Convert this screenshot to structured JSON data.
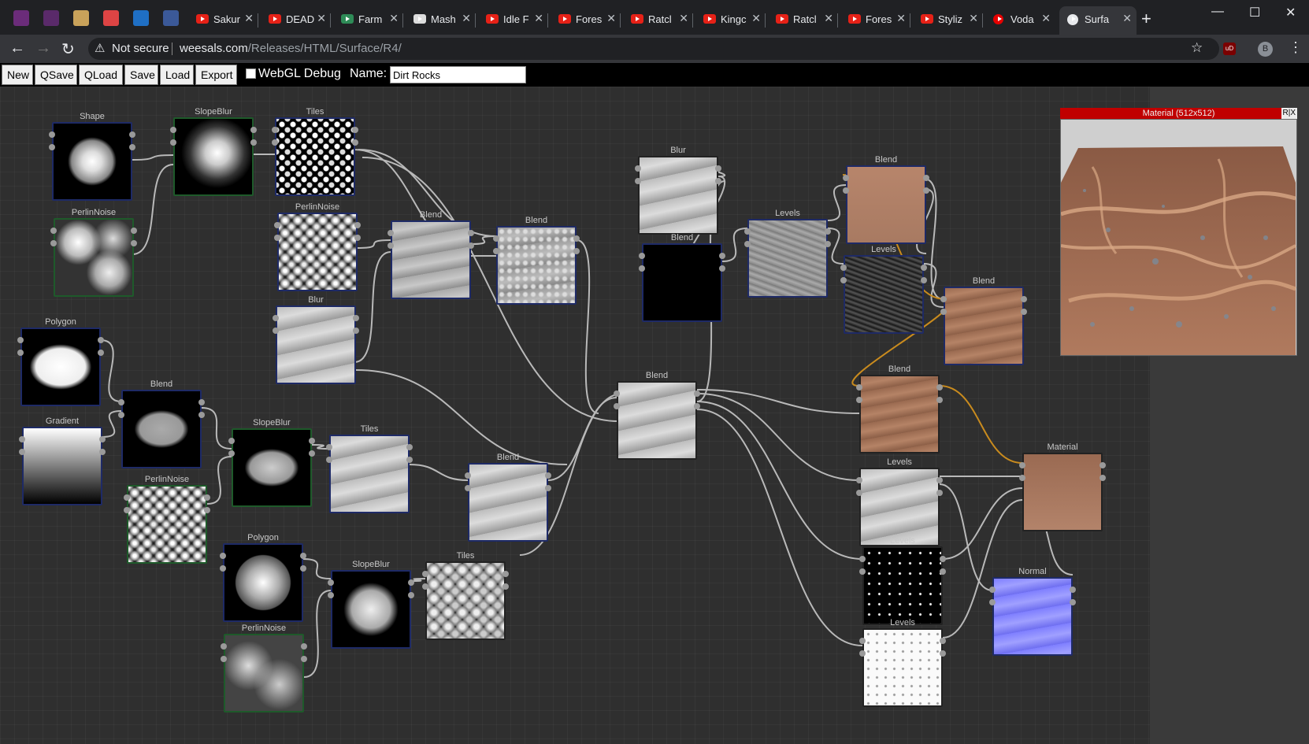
{
  "browser": {
    "tabs": [
      {
        "label": "Sakur"
      },
      {
        "label": "DEAD"
      },
      {
        "label": "Farm"
      },
      {
        "label": "Mash"
      },
      {
        "label": "Idle F"
      },
      {
        "label": "Fores"
      },
      {
        "label": "Ratcl"
      },
      {
        "label": "Kingc"
      },
      {
        "label": "Ratcl"
      },
      {
        "label": "Fores"
      },
      {
        "label": "Styliz"
      },
      {
        "label": "Voda"
      },
      {
        "label": "Surfa"
      }
    ],
    "security_label": "Not secure",
    "url_host": "weesals.com",
    "url_path": "/Releases/HTML/Surface/R4/",
    "profile_initial": "B",
    "extension_label": "uD"
  },
  "app": {
    "buttons": {
      "new": "New",
      "qsave": "QSave",
      "qload": "QLoad",
      "save": "Save",
      "load": "Load",
      "export": "Export"
    },
    "webgl_debug_label": "WebGL Debug",
    "name_label": "Name:",
    "name_value": "Dirt Rocks"
  },
  "preview": {
    "title": "Material (512x512)",
    "controls": "R|X"
  },
  "nodes": [
    {
      "id": "shape",
      "title": "Shape"
    },
    {
      "id": "slopeblur1",
      "title": "SlopeBlur"
    },
    {
      "id": "tiles1",
      "title": "Tiles"
    },
    {
      "id": "perlin1",
      "title": "PerlinNoise"
    },
    {
      "id": "perlin2",
      "title": "PerlinNoise"
    },
    {
      "id": "blend1",
      "title": "Blend"
    },
    {
      "id": "blend2",
      "title": "Blend"
    },
    {
      "id": "blur1",
      "title": "Blur"
    },
    {
      "id": "polygon1",
      "title": "Polygon"
    },
    {
      "id": "gradient",
      "title": "Gradient"
    },
    {
      "id": "blend3",
      "title": "Blend"
    },
    {
      "id": "perlin3",
      "title": "PerlinNoise"
    },
    {
      "id": "slopeblur2",
      "title": "SlopeBlur"
    },
    {
      "id": "tiles2",
      "title": "Tiles"
    },
    {
      "id": "blend4",
      "title": "Blend"
    },
    {
      "id": "polygon2",
      "title": "Polygon"
    },
    {
      "id": "slopeblur3",
      "title": "SlopeBlur"
    },
    {
      "id": "tiles3",
      "title": "Tiles"
    },
    {
      "id": "perlin4",
      "title": "PerlinNoise"
    },
    {
      "id": "blur2",
      "title": "Blur"
    },
    {
      "id": "blend5",
      "title": "Blend"
    },
    {
      "id": "blend6",
      "title": "Blend"
    },
    {
      "id": "levels1",
      "title": "Levels"
    },
    {
      "id": "blend7",
      "title": "Blend"
    },
    {
      "id": "levels2",
      "title": "Levels"
    },
    {
      "id": "blend8",
      "title": "Blend"
    },
    {
      "id": "blend9",
      "title": "Blend"
    },
    {
      "id": "levels3",
      "title": "Levels"
    },
    {
      "id": "levels4",
      "title": "Levels"
    },
    {
      "id": "levels5",
      "title": "Levels"
    },
    {
      "id": "material",
      "title": "Material"
    },
    {
      "id": "normal",
      "title": "Normal"
    }
  ]
}
